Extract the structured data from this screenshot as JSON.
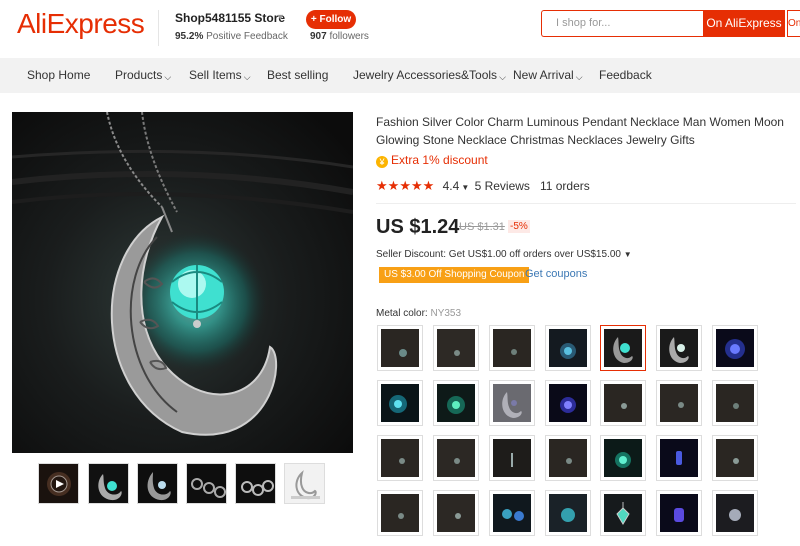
{
  "header": {
    "logo": "AliExpress",
    "store_name": "Shop5481155 Store",
    "feedback_pct": "95.2%",
    "feedback_label": "Positive Feedback",
    "follow_label": "+ Follow",
    "followers_count": "907",
    "followers_label": "followers",
    "search_placeholder": "I shop for...",
    "search_button": "On AliExpress",
    "search_button2": "On"
  },
  "nav": {
    "items": [
      {
        "label": "Shop Home"
      },
      {
        "label": "Products"
      },
      {
        "label": "Sell Items"
      },
      {
        "label": "Best selling"
      },
      {
        "label": "Jewelry Accessories&Tools"
      },
      {
        "label": "New Arrival"
      },
      {
        "label": "Feedback"
      }
    ]
  },
  "product": {
    "title": "Fashion Silver Color Charm Luminous Pendant Necklace Man Women Moon Glowing Stone Necklace Christmas Necklaces Jewelry Gifts",
    "extra_discount": "Extra 1% discount",
    "rating": 4.4,
    "rating_text": "4.4",
    "reviews": "5 Reviews",
    "orders": "11 orders",
    "price": "US $1.24",
    "old_price": "US $1.31",
    "discount_pct": "-5%",
    "seller_discount": "Seller Discount: Get US$1.00 off orders over US$15.00",
    "coupon_tag": "US $3.00 Off Shopping Coupon",
    "get_coupons": "Get coupons",
    "metal_color_label": "Metal color:",
    "metal_color_value": "NY353"
  },
  "colors": {
    "accent": "#e62e04",
    "coupon": "#f8a016",
    "link": "#3c78b4",
    "nav_bg": "#f2f2f2",
    "glow": "#3fe0d0"
  },
  "icons": {
    "discount": "coin-icon",
    "caret": "chevron-down-icon",
    "play": "play-icon",
    "star": "star-icon"
  }
}
